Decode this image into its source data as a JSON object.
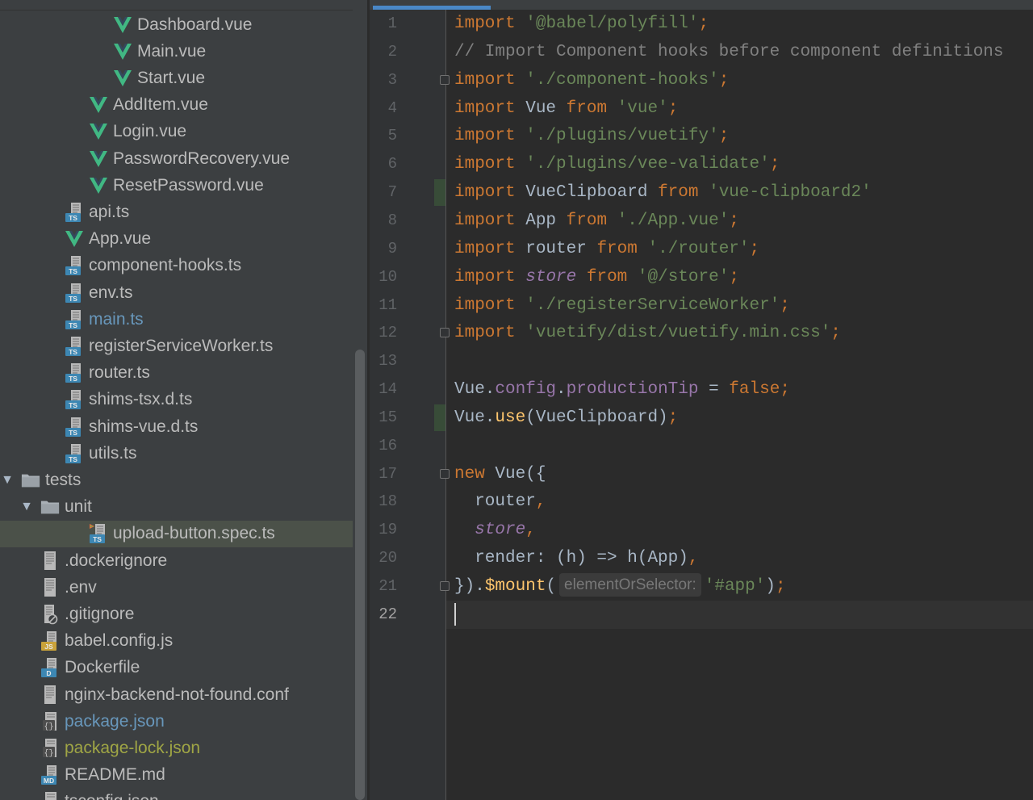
{
  "colors": {
    "sidebar_bg": "#3c3f41",
    "editor_bg": "#2b2b2b",
    "selection_bg": "#4b5149",
    "vue_green": "#41b883",
    "ts_blue": "#3d87b3",
    "keyword": "#cc7832",
    "string": "#6a8759",
    "comment": "#808080",
    "member": "#9876aa",
    "function": "#ffc66d"
  },
  "tree": [
    {
      "label": "Dashboard.vue",
      "icon": "vue-icon"
    },
    {
      "label": "Main.vue",
      "icon": "vue-icon"
    },
    {
      "label": "Start.vue",
      "icon": "vue-icon"
    },
    {
      "label": "AddItem.vue",
      "icon": "vue-icon"
    },
    {
      "label": "Login.vue",
      "icon": "vue-icon"
    },
    {
      "label": "PasswordRecovery.vue",
      "icon": "vue-icon"
    },
    {
      "label": "ResetPassword.vue",
      "icon": "vue-icon"
    },
    {
      "label": "api.ts",
      "icon": "typescript-file-icon"
    },
    {
      "label": "App.vue",
      "icon": "vue-icon"
    },
    {
      "label": "component-hooks.ts",
      "icon": "typescript-file-icon"
    },
    {
      "label": "env.ts",
      "icon": "typescript-file-icon"
    },
    {
      "label": "main.ts",
      "icon": "typescript-file-icon",
      "state": "modified"
    },
    {
      "label": "registerServiceWorker.ts",
      "icon": "typescript-file-icon"
    },
    {
      "label": "router.ts",
      "icon": "typescript-file-icon"
    },
    {
      "label": "shims-tsx.d.ts",
      "icon": "typescript-file-icon"
    },
    {
      "label": "shims-vue.d.ts",
      "icon": "typescript-file-icon"
    },
    {
      "label": "utils.ts",
      "icon": "typescript-file-icon"
    },
    {
      "label": "tests",
      "icon": "folder-icon",
      "expanded": true
    },
    {
      "label": "unit",
      "icon": "folder-icon",
      "expanded": true
    },
    {
      "label": "upload-button.spec.ts",
      "icon": "typescript-test-file-icon",
      "selected": true
    },
    {
      "label": ".dockerignore",
      "icon": "text-file-icon"
    },
    {
      "label": ".env",
      "icon": "text-file-icon"
    },
    {
      "label": ".gitignore",
      "icon": "ignore-file-icon"
    },
    {
      "label": "babel.config.js",
      "icon": "javascript-file-icon"
    },
    {
      "label": "Dockerfile",
      "icon": "docker-file-icon"
    },
    {
      "label": "nginx-backend-not-found.conf",
      "icon": "text-file-icon"
    },
    {
      "label": "package.json",
      "icon": "json-file-icon",
      "state": "modified"
    },
    {
      "label": "package-lock.json",
      "icon": "json-file-icon",
      "state": "changed"
    },
    {
      "label": "README.md",
      "icon": "markdown-file-icon"
    },
    {
      "label": "tsconfig.json",
      "icon": "json-file-icon"
    }
  ],
  "icon_badges": {
    "ts": "TS",
    "js": "JS",
    "md": "MD",
    "docker": "D",
    "json": "{}"
  },
  "editor": {
    "current_line": 22,
    "code_lines": [
      "import '@babel/polyfill';",
      "// Import Component hooks before component definitions",
      "import './component-hooks';",
      "import Vue from 'vue';",
      "import './plugins/vuetify';",
      "import './plugins/vee-validate';",
      "import VueClipboard from 'vue-clipboard2'",
      "import App from './App.vue';",
      "import router from './router';",
      "import store from '@/store';",
      "import './registerServiceWorker';",
      "import 'vuetify/dist/vuetify.min.css';",
      "",
      "Vue.config.productionTip = false;",
      "Vue.use(VueClipboard);",
      "",
      "new Vue({",
      "  router,",
      "  store,",
      "  render: (h) => h(App),",
      "}).$mount('#app');",
      ""
    ],
    "parameter_hint": "elementOrSelector:"
  }
}
